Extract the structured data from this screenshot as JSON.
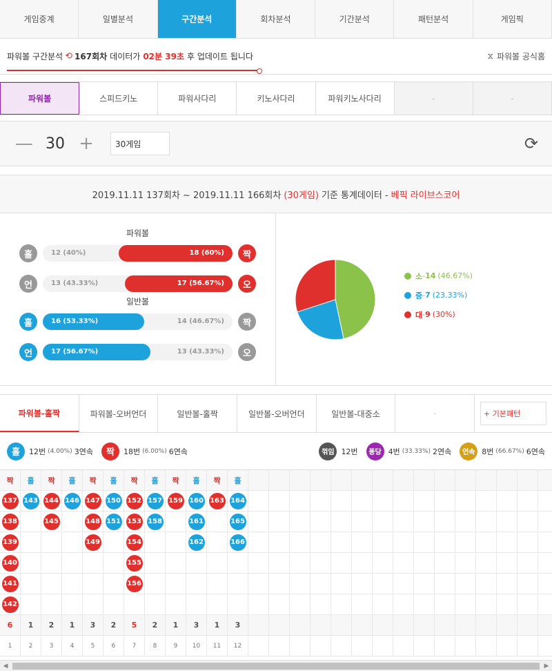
{
  "main_tabs": [
    "게임중계",
    "일별분석",
    "구간분석",
    "회차분석",
    "기간분석",
    "패턴분석",
    "게임픽"
  ],
  "update": {
    "prefix": "파워볼 구간분석",
    "round": "167회차",
    "middle": "데이터가",
    "time": "02분 39초",
    "suffix": "후 업데이트 됩니다",
    "official": "파워볼 공식홈",
    "progress": 0.46
  },
  "sub_tabs": [
    "파워볼",
    "스피드키노",
    "파워사다리",
    "키노사다리",
    "파워키노사다리",
    "-",
    "-"
  ],
  "control": {
    "minus": "—",
    "count": "30",
    "plus": "+",
    "games": "30게임"
  },
  "stats_header": {
    "range": "2019.11.11 137회차 ~ 2019.11.11 166회차",
    "games": "(30게임)",
    "mid": "기준 통계데이터 -",
    "brand": "베픽 라이브스코어"
  },
  "powerball": {
    "title": "파워볼",
    "rows": [
      {
        "left_badge": "홀",
        "left_label": "12 (40%)",
        "right_label": "18 (60%)",
        "right_badge": "짝",
        "fill": 0.6,
        "side": "right"
      },
      {
        "left_badge": "언",
        "left_label": "13 (43.33%)",
        "right_label": "17 (56.67%)",
        "right_badge": "오",
        "fill": 0.5667,
        "side": "right"
      }
    ]
  },
  "normalball": {
    "title": "일반볼",
    "rows": [
      {
        "left_badge": "홀",
        "left_label": "16 (53.33%)",
        "right_label": "14 (46.67%)",
        "right_badge": "짝",
        "fill": 0.5333,
        "side": "left"
      },
      {
        "left_badge": "언",
        "left_label": "17 (56.67%)",
        "right_label": "13 (43.33%)",
        "right_badge": "오",
        "fill": 0.5667,
        "side": "left"
      }
    ]
  },
  "pie": {
    "slices": [
      {
        "label": "소",
        "count": "14",
        "pct": "(46.67%)",
        "value": 14,
        "color": "#8bc34a"
      },
      {
        "label": "중",
        "count": "7",
        "pct": "(23.33%)",
        "value": 7,
        "color": "#1ea2dc"
      },
      {
        "label": "대",
        "count": "9",
        "pct": "(30%)",
        "value": 9,
        "color": "#e0302d"
      }
    ]
  },
  "pattern_tabs": [
    "파워볼-홀짝",
    "파워볼-오버언더",
    "일반볼-홀짝",
    "일반볼-오버언더",
    "일반볼-대중소",
    "-"
  ],
  "basic_pattern": "+ 기본패턴",
  "summary": {
    "odd_badge": "홀",
    "odd_text": "12번",
    "odd_pct": "(4.00%)",
    "odd_streak": "3연속",
    "even_badge": "짝",
    "even_text": "18번",
    "even_pct": "(6.00%)",
    "even_streak": "6연속",
    "break_badge": "꺾임",
    "break_text": "12번",
    "pong_badge": "퐁당",
    "pong_text": "4번",
    "pong_pct": "(33.33%)",
    "pong_streak": "2연속",
    "cont_badge": "연속",
    "cont_text": "8번",
    "cont_pct": "(66.67%)",
    "cont_streak": "6연속"
  },
  "pattern_columns": [
    {
      "head": "짝",
      "color": "red",
      "balls": [
        "137",
        "138",
        "139",
        "140",
        "141",
        "142"
      ],
      "count": "6",
      "index": "1"
    },
    {
      "head": "홀",
      "color": "blue",
      "balls": [
        "143"
      ],
      "count": "1",
      "index": "2"
    },
    {
      "head": "짝",
      "color": "red",
      "balls": [
        "144",
        "145"
      ],
      "count": "2",
      "index": "3"
    },
    {
      "head": "홀",
      "color": "blue",
      "balls": [
        "146"
      ],
      "count": "1",
      "index": "4"
    },
    {
      "head": "짝",
      "color": "red",
      "balls": [
        "147",
        "148",
        "149"
      ],
      "count": "3",
      "index": "5"
    },
    {
      "head": "홀",
      "color": "blue",
      "balls": [
        "150",
        "151"
      ],
      "count": "2",
      "index": "6"
    },
    {
      "head": "짝",
      "color": "red",
      "balls": [
        "152",
        "153",
        "154",
        "155",
        "156"
      ],
      "count": "5",
      "index": "7"
    },
    {
      "head": "홀",
      "color": "blue",
      "balls": [
        "157",
        "158"
      ],
      "count": "2",
      "index": "8"
    },
    {
      "head": "짝",
      "color": "red",
      "balls": [
        "159"
      ],
      "count": "1",
      "index": "9"
    },
    {
      "head": "홀",
      "color": "blue",
      "balls": [
        "160",
        "161",
        "162"
      ],
      "count": "3",
      "index": "10"
    },
    {
      "head": "짝",
      "color": "red",
      "balls": [
        "163"
      ],
      "count": "1",
      "index": "11"
    },
    {
      "head": "홀",
      "color": "blue",
      "balls": [
        "164",
        "165",
        "166"
      ],
      "count": "3",
      "index": "12"
    }
  ],
  "colors": {
    "accent": "#1ea2dc",
    "red": "#e0302d",
    "green": "#8bc34a",
    "purple": "#9c27b0"
  },
  "icons": {
    "clock": "history-clock-icon",
    "official": "link-icon",
    "refresh": "refresh-icon"
  }
}
